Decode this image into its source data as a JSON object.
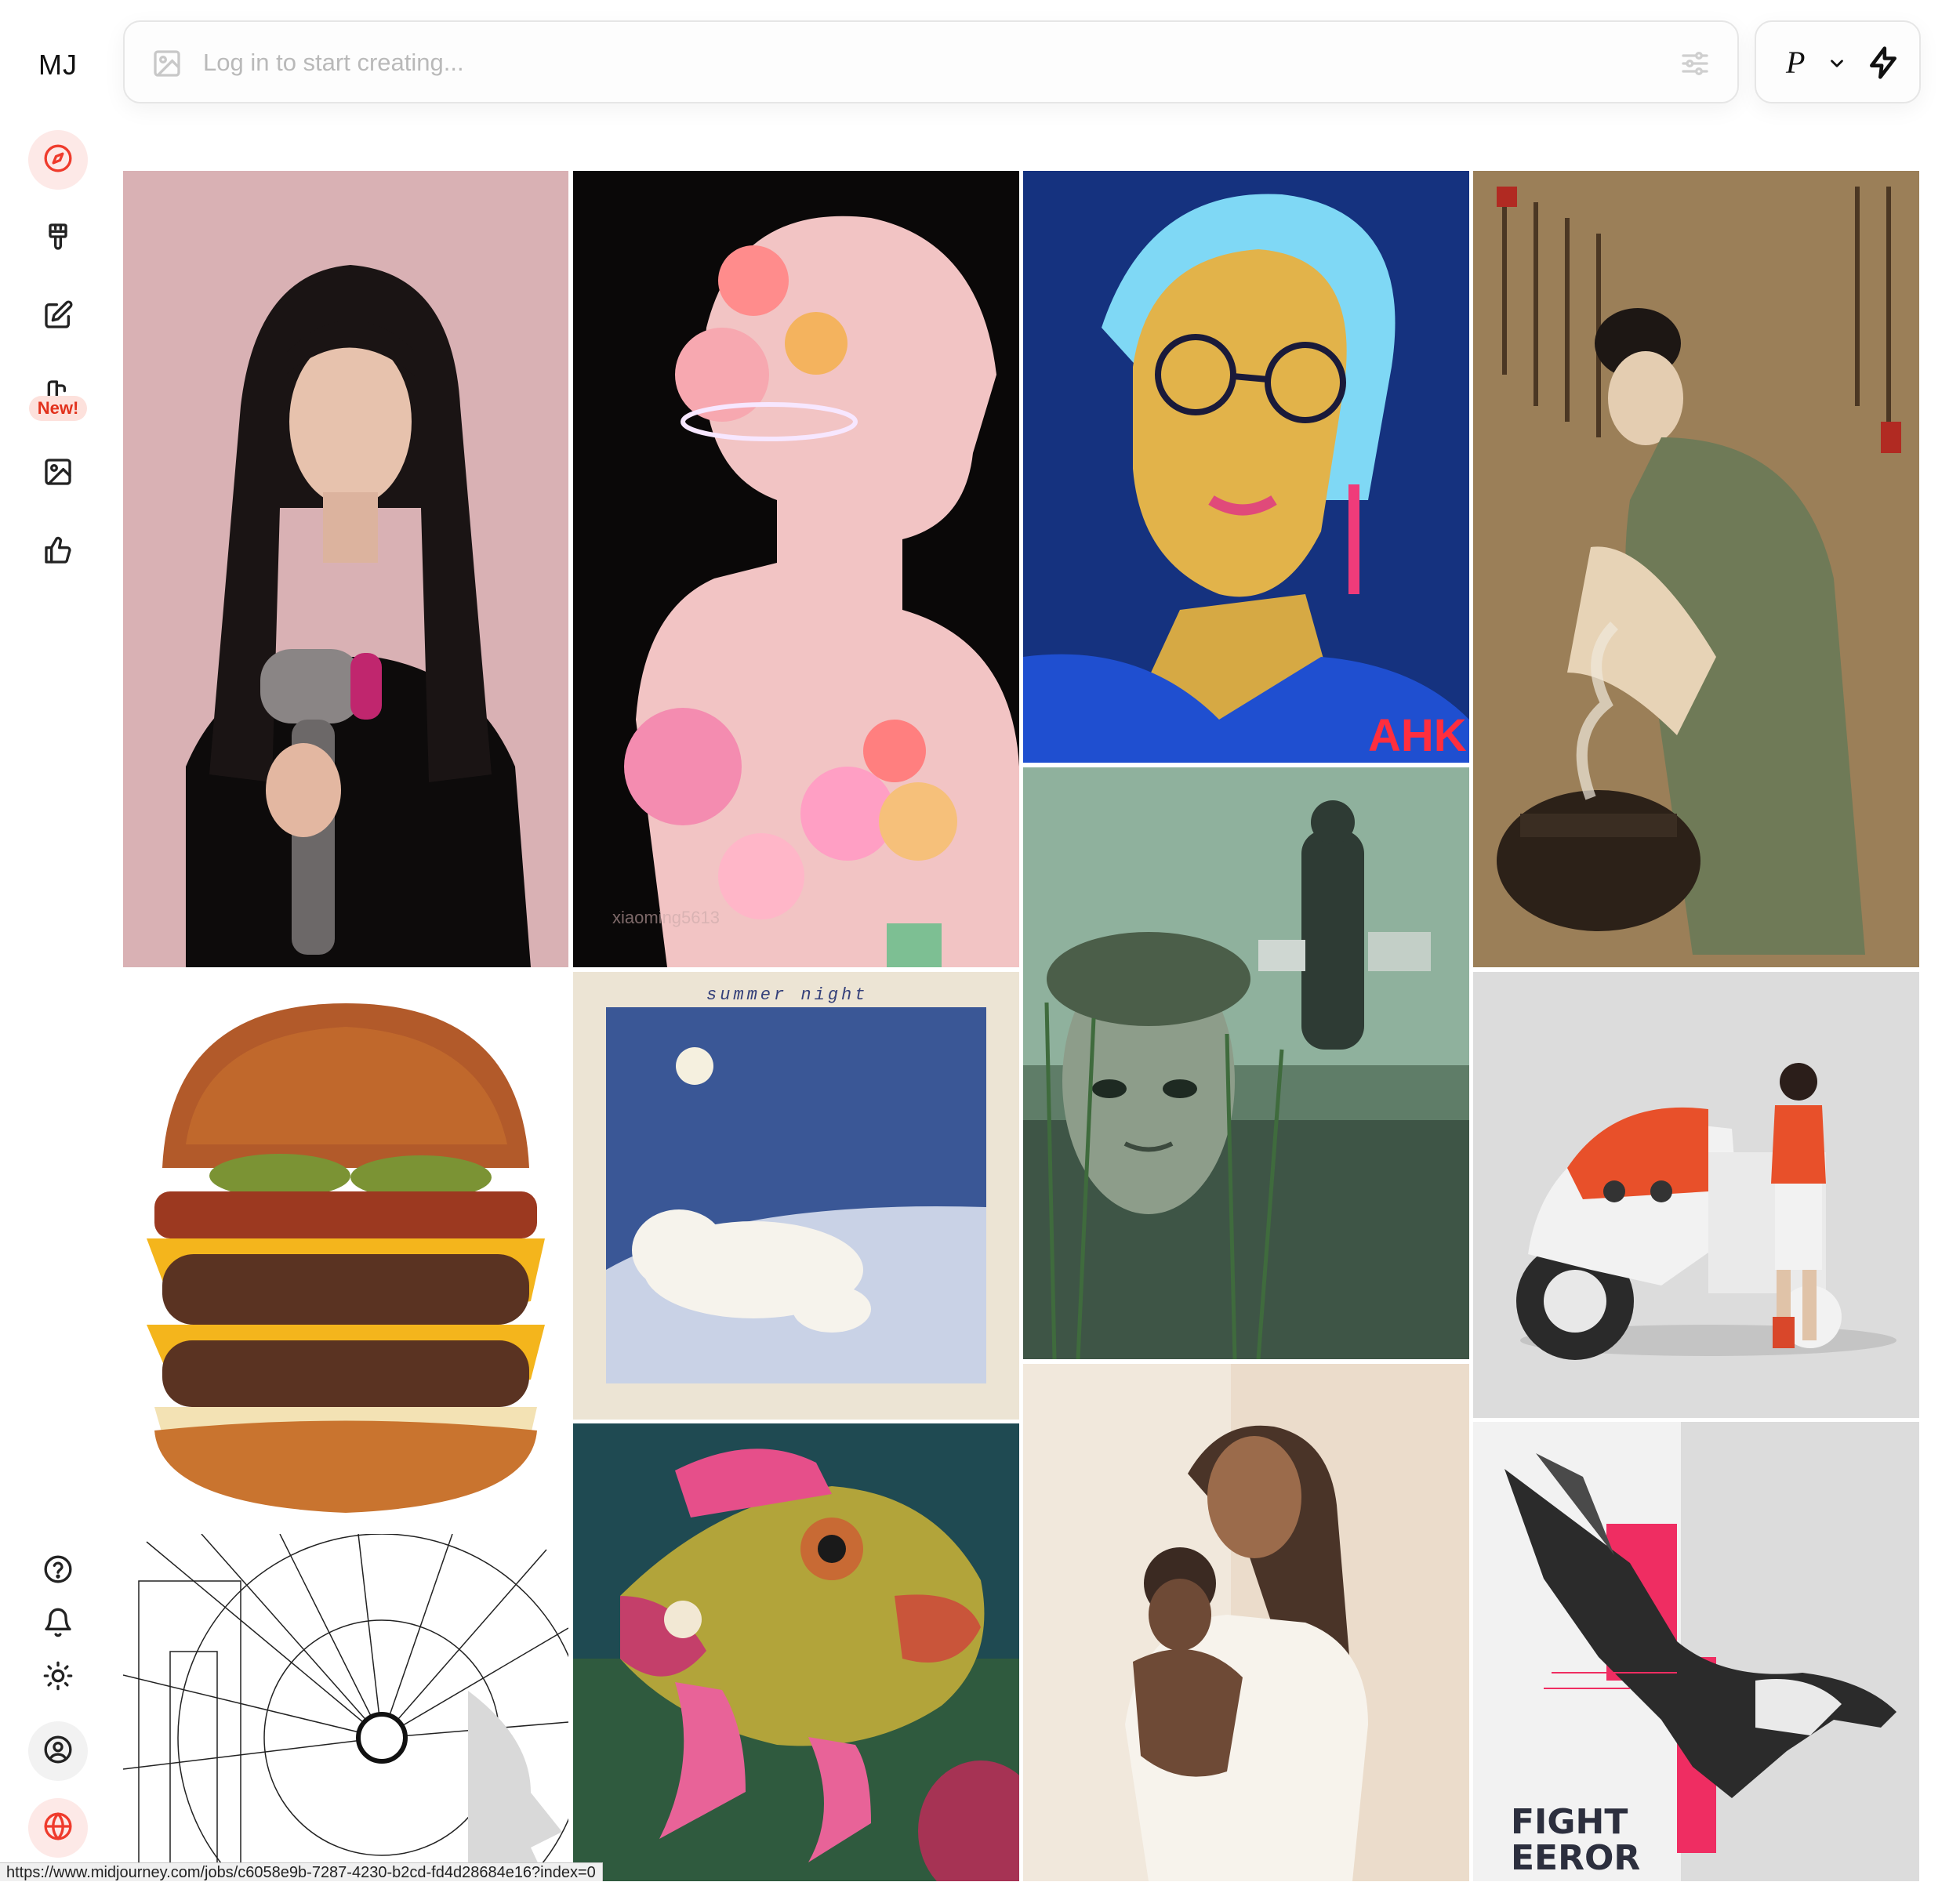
{
  "brand": {
    "logo": "MJ",
    "accent": "#ef3b2c"
  },
  "sidebar": {
    "items": [
      {
        "id": "explore",
        "icon": "compass-icon",
        "active": true
      },
      {
        "id": "create",
        "icon": "brush-icon"
      },
      {
        "id": "edit",
        "icon": "edit-icon"
      },
      {
        "id": "personalize",
        "icon": "moodboard-icon",
        "badge": "New!"
      },
      {
        "id": "organize",
        "icon": "image-icon"
      },
      {
        "id": "rate",
        "icon": "thumbs-up-icon"
      }
    ],
    "bottom": [
      {
        "id": "help",
        "icon": "help-icon"
      },
      {
        "id": "notifications",
        "icon": "bell-icon"
      },
      {
        "id": "theme",
        "icon": "sun-icon"
      },
      {
        "id": "account",
        "icon": "user-circle-icon"
      },
      {
        "id": "language",
        "icon": "globe-icon"
      }
    ]
  },
  "prompt": {
    "placeholder": "Log in to start creating..."
  },
  "mode": {
    "label": "P"
  },
  "gallery": {
    "images": [
      {
        "subject": "woman-with-hairdryer"
      },
      {
        "subject": "crystal-flower-bust",
        "watermark": "xiaoming5613"
      },
      {
        "subject": "blue-portrait-glasses",
        "signature": "AHK"
      },
      {
        "subject": "ancient-chinese-painting"
      },
      {
        "subject": "cheeseburger"
      },
      {
        "subject": "polar-bear-embroidery",
        "caption": "summer night"
      },
      {
        "subject": "swamp-mask-police"
      },
      {
        "subject": "girl-with-motorbike"
      },
      {
        "subject": "line-drawing-face"
      },
      {
        "subject": "felt-fish"
      },
      {
        "subject": "mother-and-child"
      },
      {
        "subject": "crow-poster",
        "title_line1": "FIGHT",
        "title_line2": "EEROR"
      }
    ]
  },
  "status_bar": {
    "url": "https://www.midjourney.com/jobs/c6058e9b-7287-4230-b2cd-fd4d28684e16?index=0"
  }
}
